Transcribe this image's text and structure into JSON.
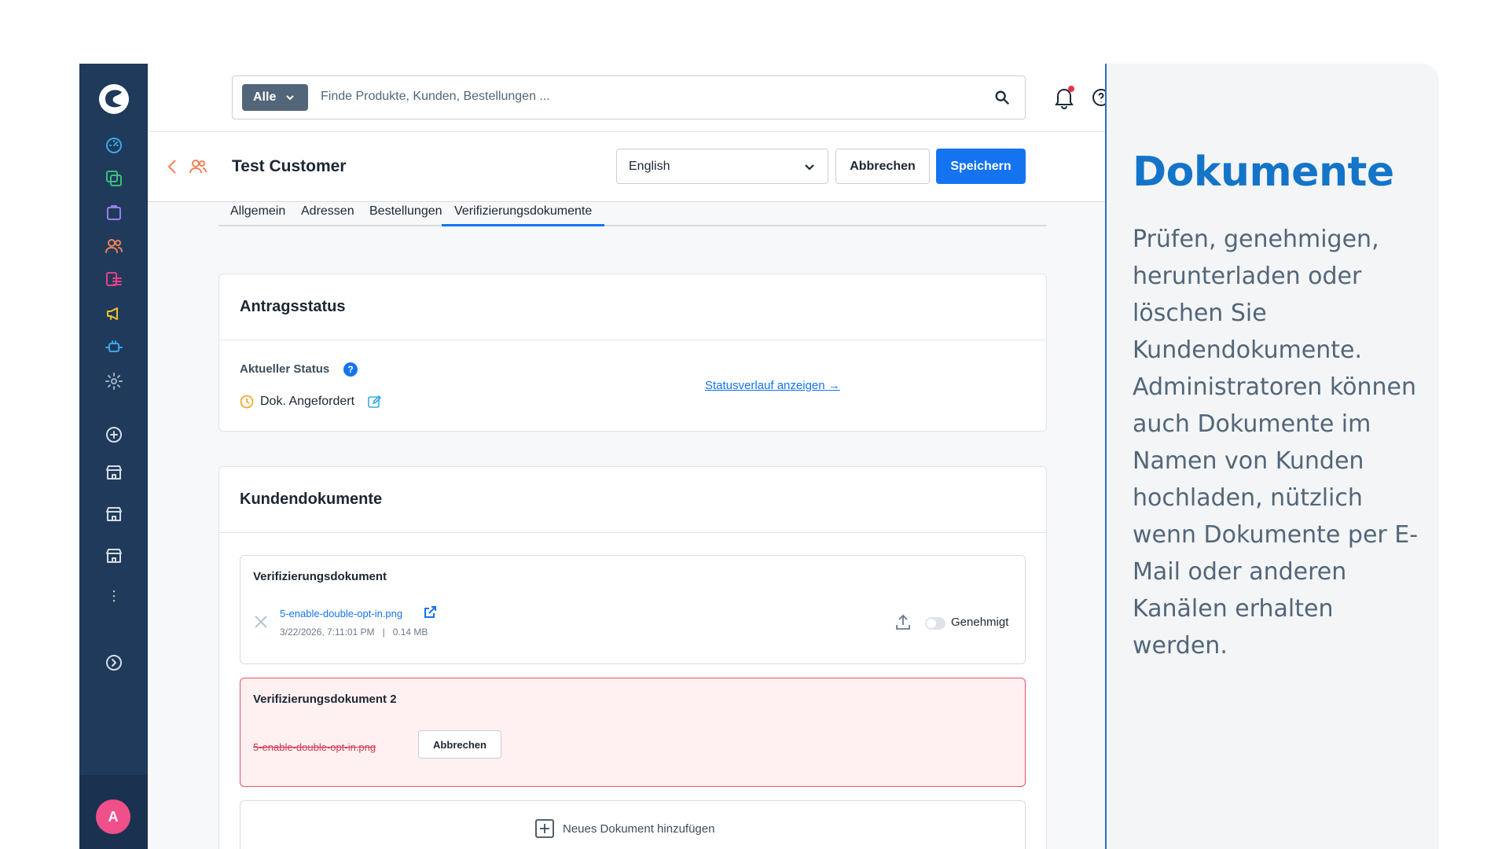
{
  "search": {
    "scope_label": "Alle",
    "placeholder": "Finde Produkte, Kunden, Bestellungen ..."
  },
  "sidebar": {
    "avatar_initial": "A",
    "icons": [
      "dashboard-icon",
      "catalog-icon",
      "orders-icon",
      "customers-icon",
      "content-icon",
      "marketing-icon",
      "extensions-icon",
      "settings-icon",
      "add-sales-channel-icon",
      "sales-channel-icon",
      "sales-channel-icon",
      "sales-channel-icon",
      "more-icon",
      "expand-icon"
    ]
  },
  "header": {
    "title": "Test Customer",
    "language": "English",
    "cancel_label": "Abbrechen",
    "save_label": "Speichern"
  },
  "tabs": [
    "Allgemein",
    "Adressen",
    "Bestellungen",
    "Verifizierungsdokumente"
  ],
  "status_card": {
    "title": "Antragsstatus",
    "current_label": "Aktueller Status",
    "help_mark": "?",
    "status_value": "Dok. Angefordert",
    "history_link": "Statusverlauf anzeigen",
    "history_arrow": "→"
  },
  "docs_card": {
    "title": "Kundendokumente",
    "doc1": {
      "title": "Verifizierungsdokument",
      "file_name": "5-enable-double-opt-in.png",
      "date": "3/22/2026, 7:11:01 PM",
      "size": "0.14 MB",
      "separator": "|",
      "approved_label": "Genehmigt"
    },
    "doc2": {
      "title": "Verifizierungsdokument 2",
      "file_name": "5-enable-double-opt-in.png",
      "cancel_label": "Abbrechen"
    },
    "add_label": "Neues Dokument hinzufügen"
  },
  "panel": {
    "heading": "Dokumente",
    "body": "Prüfen, genehmigen, herunterladen oder löschen Sie Kundendokumente. Administratoren können auch Dokumente im Namen von Kunden hochladen, nützlich wenn Dokumente per E-Mail oder anderen Kanälen erhalten werden."
  },
  "colors": {
    "sidebar": "#1f3a5b",
    "primary": "#1474f0",
    "heading_accent": "#1474c8",
    "error": "#e8536b",
    "avatar": "#f0508a"
  }
}
